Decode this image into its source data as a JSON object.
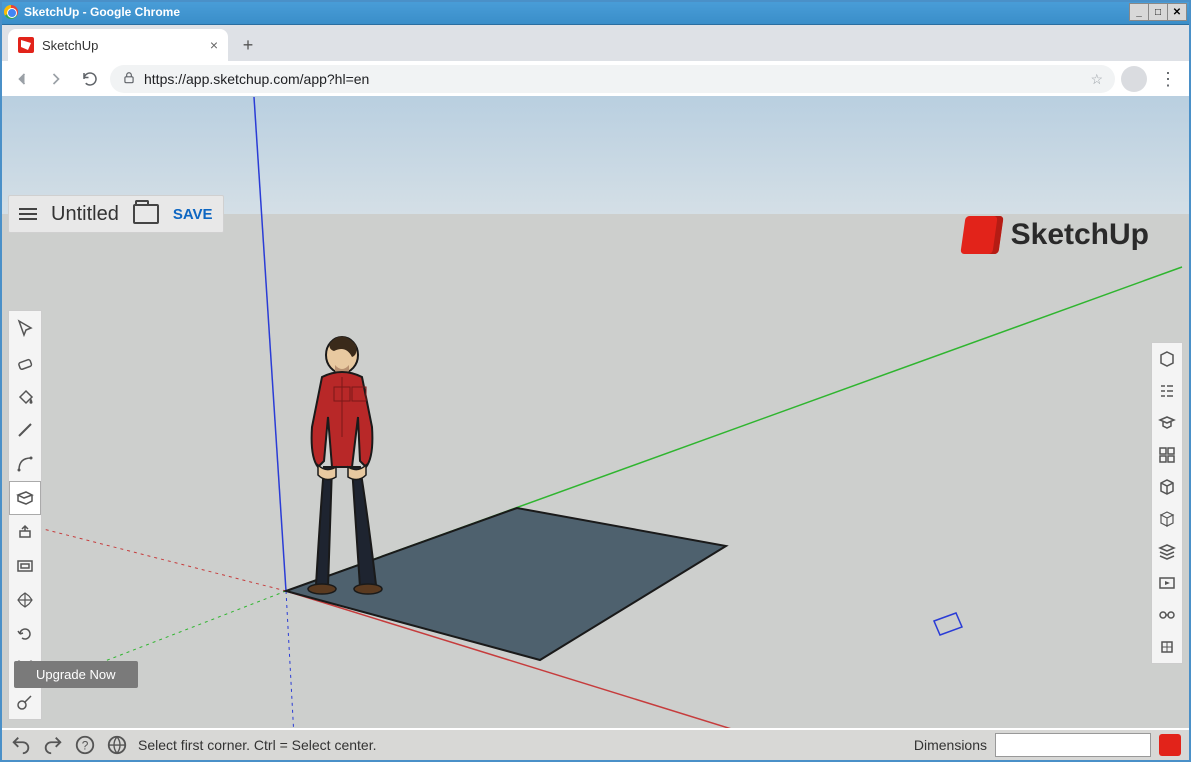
{
  "os": {
    "title": "SketchUp - Google Chrome"
  },
  "browser": {
    "tab_title": "SketchUp",
    "url": "https://app.sketchup.com/app?hl=en"
  },
  "app": {
    "doc_title": "Untitled",
    "save_label": "SAVE",
    "brand": "SketchUp"
  },
  "left_tools": [
    {
      "name": "select-tool"
    },
    {
      "name": "eraser-tool"
    },
    {
      "name": "paint-bucket-tool"
    },
    {
      "name": "line-tool"
    },
    {
      "name": "arc-tool"
    },
    {
      "name": "rectangle-tool",
      "active": true
    },
    {
      "name": "push-pull-tool"
    },
    {
      "name": "offset-tool"
    },
    {
      "name": "move-tool"
    },
    {
      "name": "rotate-tool"
    },
    {
      "name": "scale-tool"
    },
    {
      "name": "tape-measure-tool"
    }
  ],
  "right_panels": [
    {
      "name": "entity-info-panel"
    },
    {
      "name": "outliner-panel"
    },
    {
      "name": "instructor-panel"
    },
    {
      "name": "components-panel"
    },
    {
      "name": "materials-panel"
    },
    {
      "name": "styles-panel"
    },
    {
      "name": "layers-panel"
    },
    {
      "name": "scenes-panel"
    },
    {
      "name": "display-panel"
    },
    {
      "name": "model-info-panel"
    }
  ],
  "upgrade_label": "Upgrade Now",
  "status": {
    "hint": "Select first corner. Ctrl = Select center.",
    "dim_label": "Dimensions",
    "dim_value": ""
  }
}
